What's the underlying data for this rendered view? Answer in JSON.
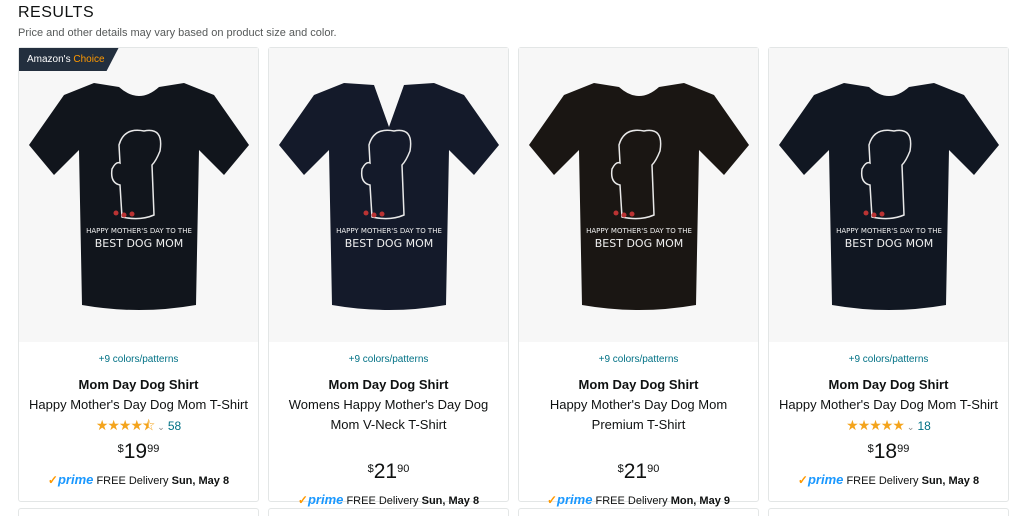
{
  "header": {
    "title": "RESULTS",
    "subtitle": "Price and other details may vary based on product size and color."
  },
  "badge": {
    "prefix": "Amazon's",
    "suffix": "Choice"
  },
  "products": [
    {
      "shirt_color": "#11151c",
      "style": "crew",
      "colors_patterns": "+9 colors/patterns",
      "brand": "Mom Day Dog Shirt",
      "title_line1": "Happy Mother's Day Dog Mom T-Shirt",
      "title_line2": "",
      "stars": "★★★★⯪",
      "rating_count": "58",
      "price_symbol": "$",
      "price_whole": "19",
      "price_fraction": "99",
      "prime_check": "✓",
      "prime_word": "prime",
      "delivery_label": "FREE Delivery",
      "delivery_date": "Sun, May 8"
    },
    {
      "shirt_color": "#141a2a",
      "style": "vneck",
      "colors_patterns": "+9 colors/patterns",
      "brand": "Mom Day Dog Shirt",
      "title_line1": "Womens Happy Mother's Day Dog",
      "title_line2": "Mom V-Neck T-Shirt",
      "stars": "",
      "rating_count": "",
      "price_symbol": "$",
      "price_whole": "21",
      "price_fraction": "90",
      "prime_check": "✓",
      "prime_word": "prime",
      "delivery_label": "FREE Delivery",
      "delivery_date": "Sun, May 8"
    },
    {
      "shirt_color": "#1a1613",
      "style": "crew",
      "colors_patterns": "+9 colors/patterns",
      "brand": "Mom Day Dog Shirt",
      "title_line1": "Happy Mother's Day Dog Mom",
      "title_line2": "Premium T-Shirt",
      "stars": "",
      "rating_count": "",
      "price_symbol": "$",
      "price_whole": "21",
      "price_fraction": "90",
      "prime_check": "✓",
      "prime_word": "prime",
      "delivery_label": "FREE Delivery",
      "delivery_date": "Mon, May 9"
    },
    {
      "shirt_color": "#111722",
      "style": "crew",
      "colors_patterns": "+9 colors/patterns",
      "brand": "Mom Day Dog Shirt",
      "title_line1": "Happy Mother's Day Dog Mom T-Shirt",
      "title_line2": "",
      "stars": "★★★★★",
      "rating_count": "18",
      "price_symbol": "$",
      "price_whole": "18",
      "price_fraction": "99",
      "prime_check": "✓",
      "prime_word": "prime",
      "delivery_label": "FREE Delivery",
      "delivery_date": "Sun, May 8"
    }
  ],
  "shirt_print": {
    "line1": "HAPPY MOTHER'S DAY TO THE",
    "line2": "BEST DOG MOM"
  }
}
